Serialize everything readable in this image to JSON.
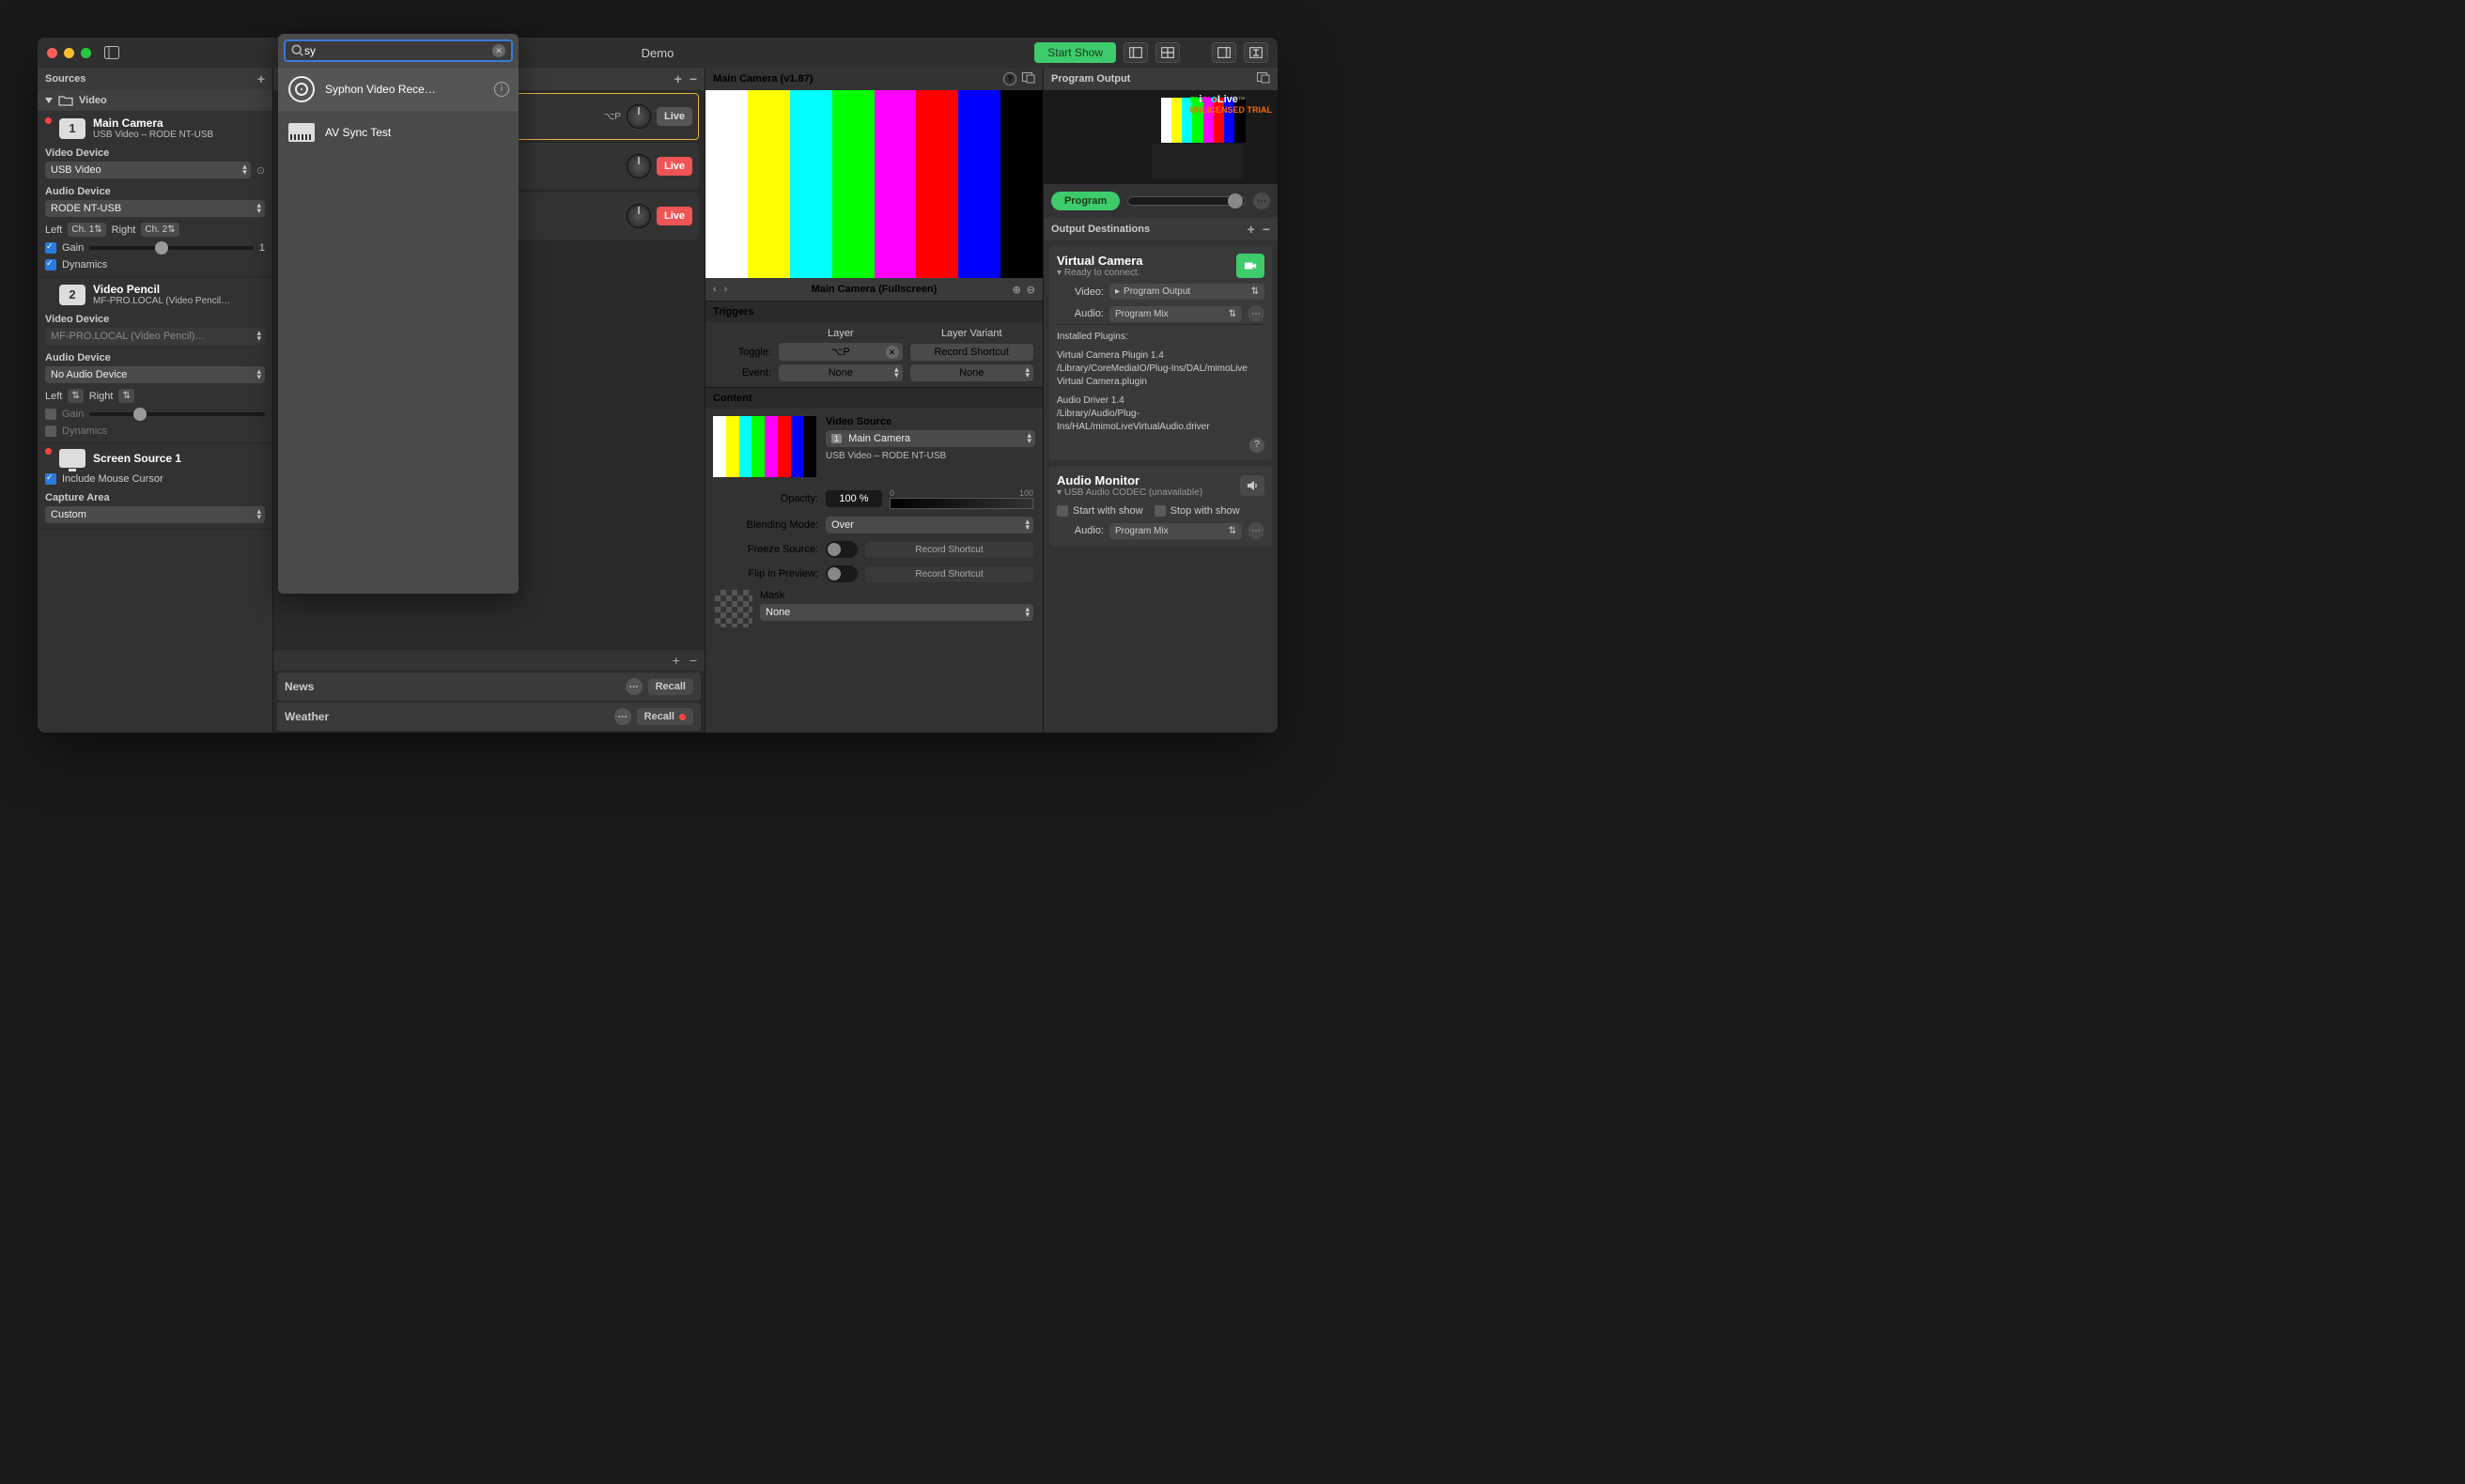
{
  "title": "Demo",
  "start_show": "Start Show",
  "sources": {
    "header": "Sources",
    "group": "Video",
    "items": [
      {
        "badge": "1",
        "title": "Main Camera",
        "sub": "USB Video – RODE NT-USB",
        "video_device_lbl": "Video Device",
        "video_device": "USB Video",
        "audio_device_lbl": "Audio Device",
        "audio_device": "RODE NT-USB",
        "left_lbl": "Left",
        "left_ch": "Ch. 1",
        "right_lbl": "Right",
        "right_ch": "Ch. 2",
        "gain_lbl": "Gain",
        "gain_val": "1",
        "dynamics": "Dynamics"
      },
      {
        "badge": "2",
        "title": "Video Pencil",
        "sub": "MF-PRO.LOCAL (Video Pencil…",
        "video_device_lbl": "Video Device",
        "video_device": "MF-PRO.LOCAL (Video Pencil)…",
        "audio_device_lbl": "Audio Device",
        "audio_device": "No Audio Device",
        "left_lbl": "Left",
        "right_lbl": "Right",
        "gain_lbl": "Gain",
        "dynamics": "Dynamics"
      },
      {
        "title": "Screen Source 1",
        "mouse_cursor": "Include Mouse Cursor",
        "capture_area_lbl": "Capture Area",
        "capture_area": "Custom"
      }
    ]
  },
  "layers": {
    "shortcut": "⌥P",
    "live": "Live",
    "sets": [
      {
        "name": "News",
        "recall": "Recall"
      },
      {
        "name": "Weather",
        "recall": "Recall"
      }
    ]
  },
  "preview": {
    "title": "Main Camera (v1.87)",
    "subtitle": "Main Camera (Fullscreen)",
    "triggers": {
      "hdr": "Triggers",
      "layer": "Layer",
      "variant": "Layer Variant",
      "toggle_lbl": "Toggle:",
      "toggle_val": "⌥P",
      "event_lbl": "Event:",
      "event_val": "None",
      "var_shortcut": "Record Shortcut",
      "var_event": "None"
    },
    "content": {
      "hdr": "Content",
      "src_lbl": "Video Source",
      "src_val": "Main Camera",
      "src_sub": "USB Video – RODE NT-USB",
      "opacity_lbl": "Opacity:",
      "opacity": "100 %",
      "op_min": "0",
      "op_max": "100",
      "blend_lbl": "Blending Mode:",
      "blend": "Over",
      "freeze_lbl": "Freeze Source:",
      "freeze_sc": "Record Shortcut",
      "flip_lbl": "Flip in Preview:",
      "flip_sc": "Record Shortcut",
      "mask_lbl": "Mask",
      "mask": "None"
    }
  },
  "output": {
    "header": "Program Output",
    "program_btn": "Program",
    "overlay": {
      "brand": "mimoLive",
      "trial": "UNLICENSED TRIAL"
    },
    "dests_hdr": "Output Destinations",
    "vcam": {
      "title": "Virtual Camera",
      "status": "Ready to connect.",
      "video_lbl": "Video:",
      "video": "Program Output",
      "audio_lbl": "Audio:",
      "audio": "Program Mix",
      "plugins_hdr": "Installed Plugins:",
      "plugin1": "Virtual Camera Plugin 1.4\n/Library/CoreMediaIO/Plug-Ins/DAL/mimoLive Virtual Camera.plugin",
      "plugin2": "Audio Driver 1.4\n/Library/Audio/Plug-Ins/HAL/mimoLiveVirtualAudio.driver"
    },
    "audio_mon": {
      "title": "Audio Monitor",
      "sub": "USB Audio CODEC  (unavailable)",
      "start": "Start with show",
      "stop": "Stop with show",
      "audio_lbl": "Audio:",
      "audio": "Program Mix"
    }
  },
  "search": {
    "query": "sy",
    "results": [
      {
        "name": "Syphon Video Rece…"
      },
      {
        "name": "AV Sync Test"
      }
    ]
  },
  "bar_colors": [
    "#ffffff",
    "#ffff00",
    "#00ffff",
    "#00ff00",
    "#ff00ff",
    "#ff0000",
    "#0000ff",
    "#000000"
  ]
}
